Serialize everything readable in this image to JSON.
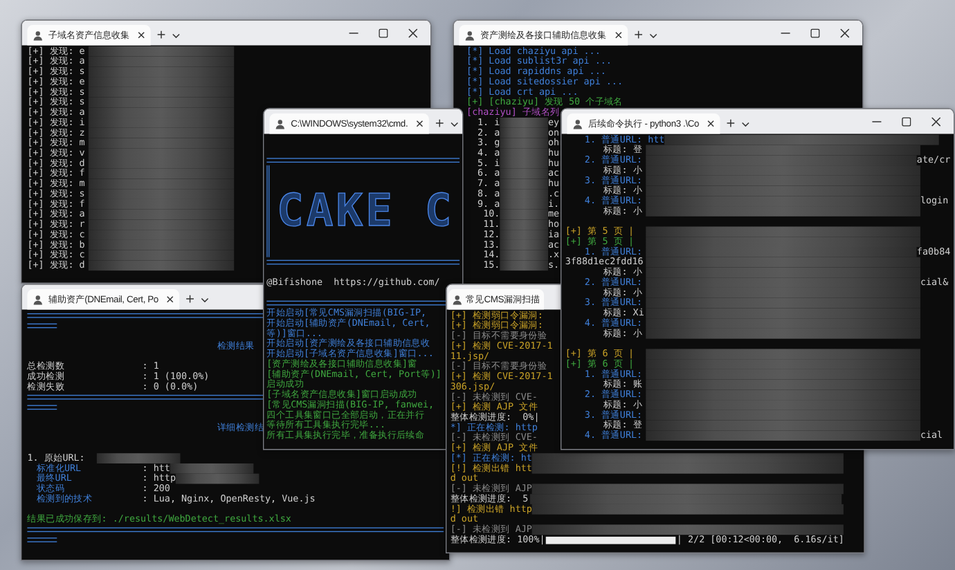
{
  "windows": [
    {
      "title": "子域名资产信息收集",
      "lines": [
        {
          "kind": "white",
          "text": "[+] 发现: e",
          "redacted": true
        },
        {
          "kind": "white",
          "text": "[+] 发现: a",
          "redacted": true
        },
        {
          "kind": "white",
          "text": "[+] 发现: s",
          "redacted": true
        },
        {
          "kind": "white",
          "text": "[+] 发现: e",
          "redacted": true
        },
        {
          "kind": "white",
          "text": "[+] 发现: s",
          "redacted": true
        },
        {
          "kind": "white",
          "text": "[+] 发现: s",
          "redacted": true
        },
        {
          "kind": "white",
          "text": "[+] 发现: a",
          "redacted": true
        },
        {
          "kind": "white",
          "text": "[+] 发现: i",
          "redacted": true
        },
        {
          "kind": "white",
          "text": "[+] 发现: z",
          "redacted": true
        },
        {
          "kind": "white",
          "text": "[+] 发现: m",
          "redacted": true
        },
        {
          "kind": "white",
          "text": "[+] 发现: v",
          "redacted": true
        },
        {
          "kind": "white",
          "text": "[+] 发现: d",
          "redacted": true
        },
        {
          "kind": "white",
          "text": "[+] 发现: f",
          "redacted": true
        },
        {
          "kind": "white",
          "text": "[+] 发现: m",
          "redacted": true
        },
        {
          "kind": "white",
          "text": "[+] 发现: s",
          "redacted": true
        },
        {
          "kind": "white",
          "text": "[+] 发现: f",
          "redacted": true
        },
        {
          "kind": "white",
          "text": "[+] 发现: a",
          "redacted": true
        },
        {
          "kind": "white",
          "text": "[+] 发现: r",
          "redacted": true
        },
        {
          "kind": "white",
          "text": "[+] 发现: c",
          "redacted": true
        },
        {
          "kind": "white",
          "text": "[+] 发现: b",
          "redacted": true
        },
        {
          "kind": "white",
          "text": "[+] 发现: c",
          "redacted": true
        },
        {
          "kind": "white",
          "text": "[+] 发现: d",
          "redacted": true
        }
      ]
    },
    {
      "title": "资产测绘及各接口辅助信息收集",
      "lines": [
        {
          "kind": "blue",
          "text": "[*] Load chaziyu api ...",
          "redacted": false
        },
        {
          "kind": "blue",
          "text": "[*] Load sublist3r api ...",
          "redacted": false
        },
        {
          "kind": "blue",
          "text": "[*] Load rapiddns api ...",
          "redacted": false
        },
        {
          "kind": "blue",
          "text": "[*] Load sitedossier api ...",
          "redacted": false
        },
        {
          "kind": "blue",
          "text": "[*] Load crt api ...",
          "redacted": false
        },
        {
          "kind": "green",
          "text": "[+] [chaziyu] 发现 50 个子域名",
          "redacted": false
        },
        {
          "kind": "purple",
          "text": "[chaziyu] 子域名列",
          "redacted": false
        },
        {
          "kind": "num",
          "text": "1. i",
          "redacted": true,
          "tail": "ey"
        },
        {
          "kind": "num",
          "text": "2. a",
          "redacted": true,
          "tail": "on"
        },
        {
          "kind": "num",
          "text": "3. g",
          "redacted": true,
          "tail": "oh"
        },
        {
          "kind": "num",
          "text": "4. a",
          "redacted": true,
          "tail": "hu"
        },
        {
          "kind": "num",
          "text": "5. i",
          "redacted": true,
          "tail": "hu"
        },
        {
          "kind": "num",
          "text": "6. a",
          "redacted": true,
          "tail": "ac"
        },
        {
          "kind": "num",
          "text": "7. a",
          "redacted": true,
          "tail": "hu"
        },
        {
          "kind": "num",
          "text": "8. a",
          "redacted": true,
          "tail": ".c"
        },
        {
          "kind": "num",
          "text": "9. a",
          "redacted": true,
          "tail": "i."
        },
        {
          "kind": "num",
          "text": "10.",
          "redacted": true,
          "tail": "me"
        },
        {
          "kind": "num",
          "text": "11.",
          "redacted": true,
          "tail": "ho"
        },
        {
          "kind": "num",
          "text": "12.",
          "redacted": true,
          "tail": "ia"
        },
        {
          "kind": "num",
          "text": "13.",
          "redacted": true,
          "tail": "ac"
        },
        {
          "kind": "num",
          "text": "14.",
          "redacted": true,
          "tail": ".x"
        },
        {
          "kind": "num",
          "text": "15.",
          "redacted": true,
          "tail": "s."
        }
      ]
    },
    {
      "title": "C:\\WINDOWS\\system32\\cmd.",
      "lines": [
        {
          "kind": "blank",
          "redacted": false
        },
        {
          "kind": "blank",
          "redacted": false
        },
        {
          "kind": "rule",
          "redacted": false
        },
        {
          "kind": "banner",
          "text": "CAKE C",
          "redacted": false
        },
        {
          "kind": "rule",
          "redacted": false
        },
        {
          "kind": "blank",
          "redacted": false
        },
        {
          "kind": "white",
          "text": "@Bifishone  https://github.com/",
          "redacted": false
        },
        {
          "kind": "blank",
          "redacted": false
        },
        {
          "kind": "rule",
          "redacted": false
        },
        {
          "kind": "blue",
          "text": "开始启动[常见CMS漏洞扫描(BIG-IP,",
          "redacted": false
        },
        {
          "kind": "blue",
          "text": "开始启动[辅助资产(DNEmail, Cert,",
          "redacted": false
        },
        {
          "kind": "blue",
          "text": "等)]窗口...",
          "redacted": false
        },
        {
          "kind": "blue",
          "text": "开始启动[资产测绘及各接口辅助信息收",
          "redacted": false
        },
        {
          "kind": "blue",
          "text": "开始启动[子域名资产信息收集]窗口...",
          "redacted": false
        },
        {
          "kind": "green",
          "text": "[资产测绘及各接口辅助信息收集]窗",
          "redacted": false
        },
        {
          "kind": "green",
          "text": "[辅助资产(DNEmail, Cert, Port等)]",
          "redacted": false
        },
        {
          "kind": "green",
          "text": "启动成功",
          "redacted": false
        },
        {
          "kind": "green",
          "text": "[子域名资产信息收集]窗口启动成功",
          "redacted": false
        },
        {
          "kind": "green",
          "text": "[常见CMS漏洞扫描(BIG-IP, fanwei,",
          "redacted": false
        },
        {
          "kind": "green",
          "text": "四个工具集窗口已全部启动，正在并行",
          "redacted": false
        },
        {
          "kind": "green",
          "text": "等待所有工具集执行完毕...",
          "redacted": false
        },
        {
          "kind": "green",
          "text": "所有工具集执行完毕，准备执行后续命",
          "redacted": false
        }
      ]
    },
    {
      "title": "后续命令执行 - python3 .\\Co",
      "lines": [
        {
          "kind": "url",
          "text": "1. 普通URL: htt",
          "redacted": true
        },
        {
          "kind": "title",
          "text": "标题: 登",
          "redacted": true
        },
        {
          "kind": "url",
          "text": "2. 普通URL:",
          "redacted": true,
          "tail": "ate/cr"
        },
        {
          "kind": "title",
          "text": "标题: 小",
          "redacted": true
        },
        {
          "kind": "url",
          "text": "3. 普通URL:",
          "redacted": true
        },
        {
          "kind": "title",
          "text": "标题: 小",
          "redacted": true
        },
        {
          "kind": "url",
          "text": "4. 普通URL:",
          "redacted": true,
          "tail": "login"
        },
        {
          "kind": "title",
          "text": "标题: 小",
          "redacted": true
        },
        {
          "kind": "blank",
          "redacted": false
        },
        {
          "kind": "yellow",
          "text": "[+] 第 5 页 |",
          "redacted": true
        },
        {
          "kind": "green",
          "text": "[+] 第 5 页 |",
          "redacted": true
        },
        {
          "kind": "url",
          "text": "1. 普通URL:",
          "redacted": true,
          "tail": "fa0b84"
        },
        {
          "kind": "hash",
          "text": "3f88d1ec2fdd16",
          "redacted": true
        },
        {
          "kind": "title",
          "text": "标题: 小",
          "redacted": true
        },
        {
          "kind": "url",
          "text": "2. 普通URL:",
          "redacted": true,
          "tail": "cial&"
        },
        {
          "kind": "title",
          "text": "标题: 小",
          "redacted": true
        },
        {
          "kind": "url",
          "text": "3. 普通URL:",
          "redacted": true
        },
        {
          "kind": "title",
          "text": "标题: Xi",
          "redacted": true
        },
        {
          "kind": "url",
          "text": "4. 普通URL:",
          "redacted": true
        },
        {
          "kind": "title",
          "text": "标题: 小",
          "redacted": true
        },
        {
          "kind": "blank",
          "redacted": false
        },
        {
          "kind": "yellow",
          "text": "[+] 第 6 页 |",
          "redacted": true
        },
        {
          "kind": "green",
          "text": "[+] 第 6 页 |",
          "redacted": true
        },
        {
          "kind": "url",
          "text": "1. 普通URL:",
          "redacted": true
        },
        {
          "kind": "title",
          "text": "标题: 账",
          "redacted": true
        },
        {
          "kind": "url",
          "text": "2. 普通URL:",
          "redacted": true
        },
        {
          "kind": "title",
          "text": "标题: 小",
          "redacted": true
        },
        {
          "kind": "url",
          "text": "3. 普通URL:",
          "redacted": true
        },
        {
          "kind": "title",
          "text": "标题: 登",
          "redacted": true
        },
        {
          "kind": "url",
          "text": "4. 普通URL:",
          "redacted": true,
          "tail": "cial"
        }
      ]
    },
    {
      "title": "辅助资产(DNEmail, Cert, Po",
      "lines": [
        {
          "kind": "rule",
          "redacted": false
        },
        {
          "kind": "short_rule",
          "redacted": false
        },
        {
          "kind": "blank",
          "redacted": false
        },
        {
          "kind": "heading",
          "text": "检测结果",
          "redacted": false
        },
        {
          "kind": "blank",
          "redacted": false
        },
        {
          "kind": "kv",
          "text": "总检测数",
          "value": ": 1",
          "redacted": false
        },
        {
          "kind": "kv",
          "text": "成功检测",
          "value": ": 1 (100.0%)",
          "redacted": false
        },
        {
          "kind": "kv",
          "text": "检测失败",
          "value": ": 0 (0.0%)",
          "redacted": false
        },
        {
          "kind": "rule",
          "redacted": false
        },
        {
          "kind": "short_rule",
          "redacted": false
        },
        {
          "kind": "blank",
          "redacted": false
        },
        {
          "kind": "heading",
          "text": "详细检测结",
          "redacted": false
        },
        {
          "kind": "blank",
          "redacted": false
        },
        {
          "kind": "blank",
          "redacted": false
        },
        {
          "kind": "white",
          "text": "1. 原始URL:",
          "redacted": true
        },
        {
          "kind": "subkv",
          "text": "标准化URL",
          "value": ": htt",
          "redacted": true
        },
        {
          "kind": "subkv",
          "text": "最终URL",
          "value": ": http",
          "redacted": true
        },
        {
          "kind": "subkv",
          "text": "状态码",
          "value": ": 200",
          "redacted": false
        },
        {
          "kind": "subkv",
          "text": "检测到的技术",
          "value": ": Lua, Nginx, OpenResty, Vue.js",
          "redacted": false
        },
        {
          "kind": "blank",
          "redacted": false
        },
        {
          "kind": "green",
          "text": "结果已成功保存到: ./results/WebDetect_results.xlsx",
          "redacted": false
        },
        {
          "kind": "rule",
          "redacted": false
        },
        {
          "kind": "short_rule",
          "redacted": false
        }
      ]
    },
    {
      "title": "常见CMS漏洞扫描",
      "lines": [
        {
          "kind": "yellow",
          "text": "[+] 检测弱口令漏洞:",
          "redacted": false
        },
        {
          "kind": "yellow",
          "text": "[+] 检测弱口令漏洞:",
          "redacted": false
        },
        {
          "kind": "gray",
          "text": "[-] 目标不需要身份验",
          "redacted": false
        },
        {
          "kind": "yellow",
          "text": "[+] 检测 CVE-2017-1",
          "redacted": false
        },
        {
          "kind": "yellow",
          "text": "11.jsp/",
          "redacted": false
        },
        {
          "kind": "gray",
          "text": "[-] 目标不需要身份验",
          "redacted": false
        },
        {
          "kind": "yellow",
          "text": "[+] 检测 CVE-2017-1",
          "redacted": false
        },
        {
          "kind": "yellow",
          "text": "306.jsp/",
          "redacted": false
        },
        {
          "kind": "gray",
          "text": "[-] 未检测到 CVE-",
          "redacted": false
        },
        {
          "kind": "yellow",
          "text": "[+] 检测 AJP 文件",
          "redacted": false
        },
        {
          "kind": "white",
          "text": "整体检测进度:  0%|",
          "redacted": false
        },
        {
          "kind": "blue",
          "text": "*] 正在检测: http",
          "redacted": false
        },
        {
          "kind": "gray",
          "text": "[-] 未检测到 CVE-",
          "redacted": false
        },
        {
          "kind": "yellow",
          "text": "[+] 检测 AJP 文件",
          "redacted": false
        },
        {
          "kind": "blue",
          "text": "[*] 正在检测: ht",
          "redacted": true
        },
        {
          "kind": "yellow",
          "text": "[!] 检测出错 htt",
          "redacted": true
        },
        {
          "kind": "yellow",
          "text": "d out",
          "redacted": false
        },
        {
          "kind": "gray",
          "text": "[-] 未检测到 AJP",
          "redacted": true
        },
        {
          "kind": "white",
          "text": "整体检测进度:  5",
          "redacted": true
        },
        {
          "kind": "yellow",
          "text": "!] 检测出错 http",
          "redacted": true
        },
        {
          "kind": "yellow",
          "text": "d out",
          "redacted": false
        },
        {
          "kind": "gray",
          "text": "[-] 未检测到 AJP",
          "redacted": true
        },
        {
          "kind": "progress",
          "text": "整体检测进度: 100%|",
          "level": 1,
          "tail": "| 2/2 [00:12<00:00,  6.16s/it]",
          "redacted": false
        }
      ]
    }
  ]
}
